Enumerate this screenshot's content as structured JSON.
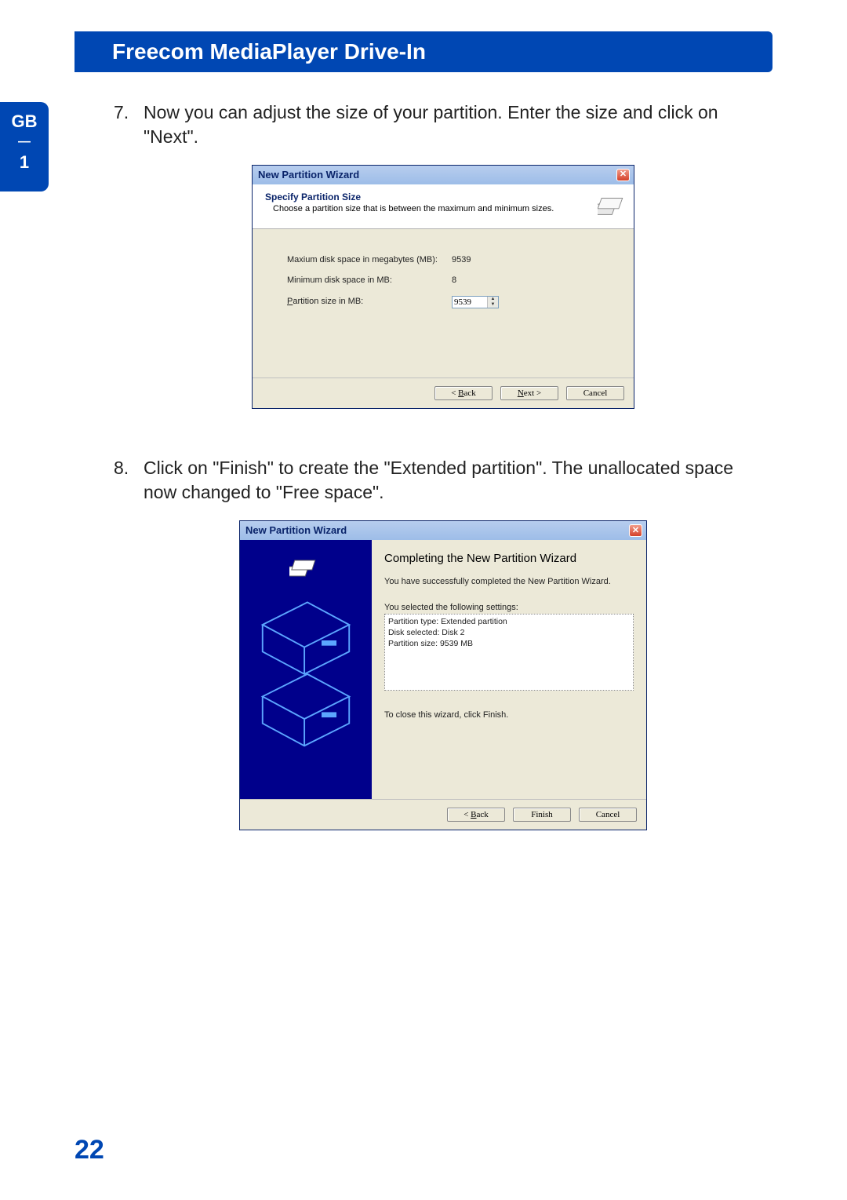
{
  "header": {
    "title": "Freecom MediaPlayer Drive-In"
  },
  "sidetab": {
    "region": "GB",
    "chapter": "1"
  },
  "steps": {
    "s7_num": "7.",
    "s7_text": "Now you can adjust the size of your partition. Enter the size and click on \"Next\".",
    "s8_num": "8.",
    "s8_text": "Click on \"Finish\" to create the \"Extended partition\". The unallocated space now changed to \"Free space\"."
  },
  "dialog1": {
    "title": "New Partition Wizard",
    "header_title": "Specify Partition Size",
    "header_sub": "Choose a partition size that is between the maximum and minimum sizes.",
    "max_label": "Maxium disk space in megabytes (MB):",
    "max_val": "9539",
    "min_label": "Minimum disk space in MB:",
    "min_val": "8",
    "size_label": "Partition size in MB:",
    "size_val": "9539",
    "back": "Back",
    "next": "Next >",
    "cancel": "Cancel"
  },
  "dialog2": {
    "title": "New Partition Wizard",
    "completion_title": "Completing the New Partition Wizard",
    "msg": "You have successfully completed the New Partition Wizard.",
    "settings_intro": "You selected the following settings:",
    "settings_line1": "Partition type: Extended partition",
    "settings_line2": "Disk selected: Disk 2",
    "settings_line3": "Partition size: 9539 MB",
    "closing": "To close this wizard, click Finish.",
    "back": "Back",
    "finish": "Finish",
    "cancel": "Cancel"
  },
  "page_number": "22"
}
